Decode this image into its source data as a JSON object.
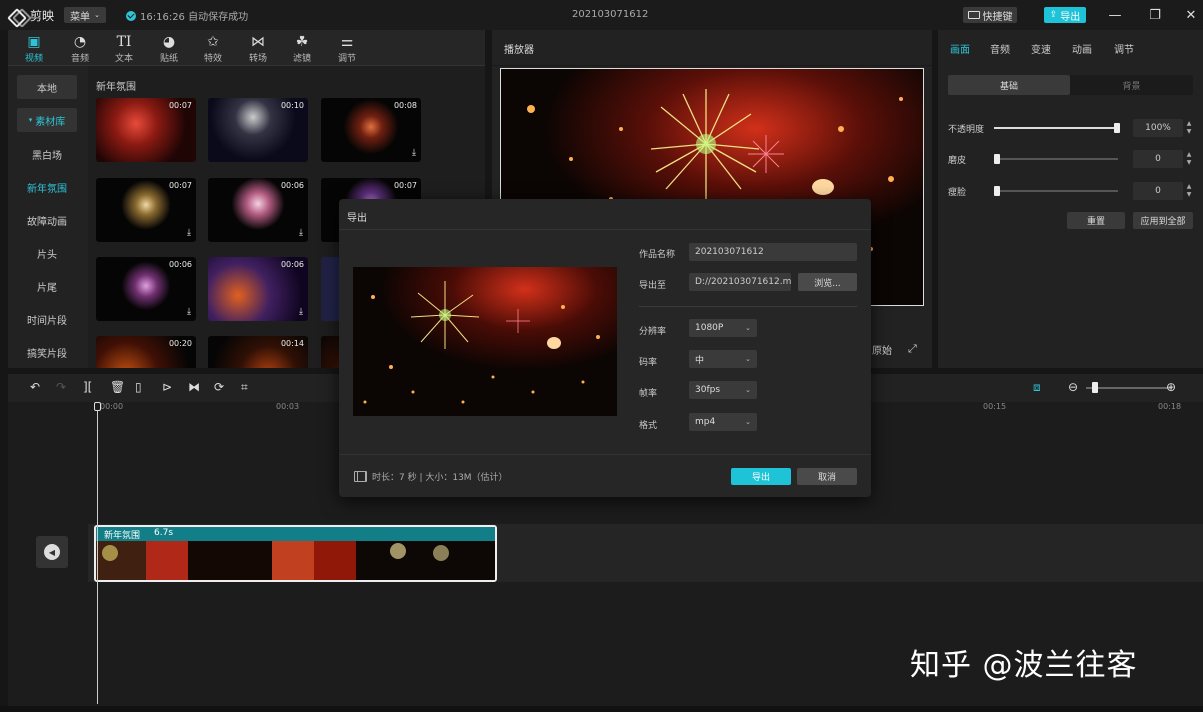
{
  "app": {
    "name": "剪映",
    "menu_label": "菜单",
    "autosave": "16:16:26 自动保存成功",
    "project_title": "202103071612",
    "shortcut_label": "快捷键",
    "export_label": "导出"
  },
  "colors": {
    "accent": "#1ec3d8",
    "panel": "#222222",
    "background": "#161616"
  },
  "toolbar": {
    "tabs": [
      {
        "label": "视频",
        "icon": "video-icon"
      },
      {
        "label": "音频",
        "icon": "audio-icon"
      },
      {
        "label": "文本",
        "icon": "text-icon"
      },
      {
        "label": "贴纸",
        "icon": "sticker-icon"
      },
      {
        "label": "特效",
        "icon": "effects-icon"
      },
      {
        "label": "转场",
        "icon": "transition-icon"
      },
      {
        "label": "滤镜",
        "icon": "filter-icon"
      },
      {
        "label": "调节",
        "icon": "adjust-icon"
      }
    ],
    "active": "视频"
  },
  "sidebar": {
    "items": [
      "本地",
      "素材库",
      "黑白场",
      "新年氛围",
      "故障动画",
      "片头",
      "片尾",
      "时间片段",
      "搞笑片段"
    ],
    "active": "新年氛围"
  },
  "library": {
    "category_title": "新年氛围",
    "items": [
      {
        "duration": "00:07",
        "downloaded": true
      },
      {
        "duration": "00:10",
        "downloaded": true
      },
      {
        "duration": "00:08",
        "downloaded": false
      },
      {
        "duration": "00:07",
        "downloaded": false
      },
      {
        "duration": "00:06",
        "downloaded": false
      },
      {
        "duration": "00:07",
        "downloaded": false
      },
      {
        "duration": "00:06",
        "downloaded": false
      },
      {
        "duration": "00:06",
        "downloaded": true
      },
      {
        "duration": "",
        "downloaded": true
      },
      {
        "duration": "00:20",
        "downloaded": true
      },
      {
        "duration": "00:14",
        "downloaded": true
      },
      {
        "duration": "",
        "downloaded": true
      }
    ]
  },
  "player": {
    "title": "播放器",
    "ratio_label": "原始"
  },
  "inspector": {
    "tabs": [
      "画面",
      "音频",
      "变速",
      "动画",
      "调节"
    ],
    "active_tab": "画面",
    "sub_tabs": [
      "基础",
      "背景"
    ],
    "opacity": {
      "label": "不透明度",
      "value": "100%",
      "level": 1.0
    },
    "smooth": {
      "label": "磨皮",
      "value": "0",
      "level": 0
    },
    "slim": {
      "label": "瘦脸",
      "value": "0",
      "level": 0
    },
    "reset_label": "重置",
    "apply_all_label": "应用到全部"
  },
  "timeline": {
    "ticks": [
      "00:00",
      "00:03",
      "00:15",
      "00:18"
    ],
    "clip": {
      "name": "新年氛围",
      "duration": "6.7s"
    }
  },
  "export_dialog": {
    "title": "导出",
    "name_label": "作品名称",
    "name_value": "202103071612",
    "path_label": "导出至",
    "path_value": "D://202103071612.mp4",
    "browse_label": "浏览...",
    "resolution_label": "分辨率",
    "resolution_value": "1080P",
    "bitrate_label": "码率",
    "bitrate_value": "中",
    "fps_label": "帧率",
    "fps_value": "30fps",
    "format_label": "格式",
    "format_value": "mp4",
    "info": "时长：7 秒 | 大小：13M（估计）",
    "export_button": "导出",
    "cancel_button": "取消"
  },
  "watermark": "知乎 @波兰往客"
}
